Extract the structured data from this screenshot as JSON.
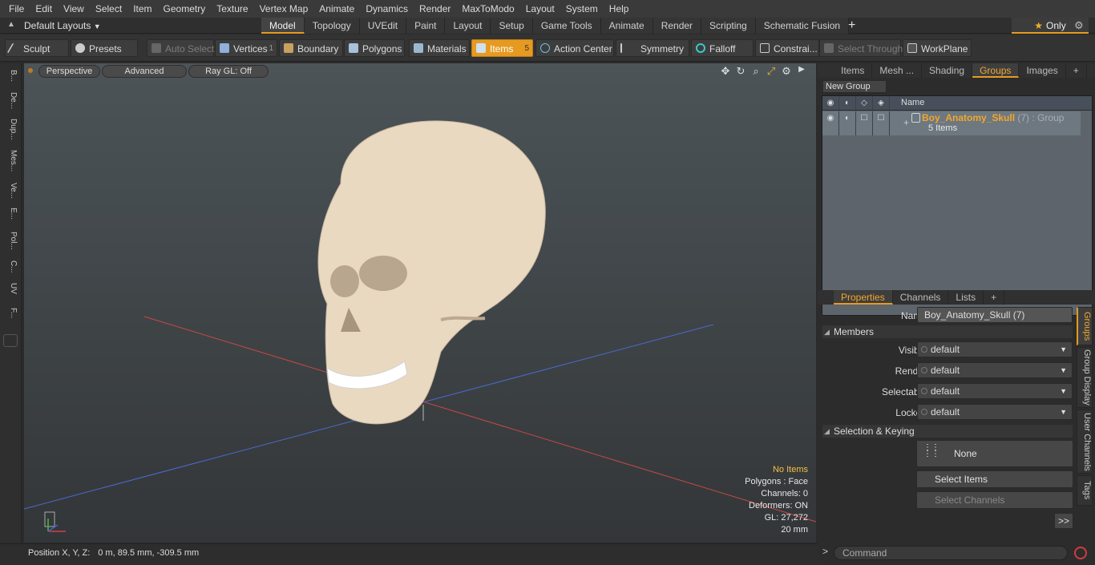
{
  "menu": [
    "File",
    "Edit",
    "View",
    "Select",
    "Item",
    "Geometry",
    "Texture",
    "Vertex Map",
    "Animate",
    "Dynamics",
    "Render",
    "MaxToModo",
    "Layout",
    "System",
    "Help"
  ],
  "layout_dropdown": "Default Layouts",
  "layout_tabs": [
    {
      "label": "Model",
      "active": true
    },
    {
      "label": "Topology"
    },
    {
      "label": "UVEdit"
    },
    {
      "label": "Paint"
    },
    {
      "label": "Layout"
    },
    {
      "label": "Setup"
    },
    {
      "label": "Game Tools"
    },
    {
      "label": "Animate"
    },
    {
      "label": "Render"
    },
    {
      "label": "Scripting"
    },
    {
      "label": "Schematic Fusion"
    }
  ],
  "tab_add": "+",
  "only_label": "Only",
  "toolbar": {
    "sculpt": "Sculpt",
    "presets": "Presets",
    "auto_select": "Auto Select",
    "vertices": "Vertices",
    "vertices_count": "1",
    "boundary": "Boundary",
    "polygons": "Polygons",
    "materials": "Materials",
    "items": "Items",
    "items_count": "5",
    "action_center": "Action Center",
    "symmetry": "Symmetry",
    "falloff": "Falloff",
    "constraints": "Constrai...",
    "select_through": "Select Through",
    "workplane": "WorkPlane"
  },
  "left_strip": [
    "B...",
    "De...",
    "Dup...",
    "Mes...",
    "Ve...",
    "E...",
    "Pol...",
    "C...",
    "UV",
    "F..."
  ],
  "viewport": {
    "view_mode": "Perspective",
    "shading": "Advanced",
    "raygl": "Ray GL: Off",
    "stats": {
      "selection": "No Items",
      "polygons": "Polygons : Face",
      "channels": "Channels: 0",
      "deformers": "Deformers: ON",
      "gl": "GL: 27,272",
      "scale": "20 mm"
    }
  },
  "status_bar": {
    "label": "Position X, Y, Z:",
    "value": "0 m, 89.5 mm, -309.5 mm"
  },
  "panel_top": {
    "tabs": [
      {
        "label": "Items"
      },
      {
        "label": "Mesh ..."
      },
      {
        "label": "Shading"
      },
      {
        "label": "Groups",
        "active": true
      },
      {
        "label": "Images"
      }
    ],
    "new_group": "New Group",
    "col_name": "Name",
    "group": {
      "name": "Boy_Anatomy_Skull",
      "count": "(7)",
      "type": ": Group",
      "sub": "5 Items"
    }
  },
  "panel_props": {
    "tabs": [
      {
        "label": "Properties",
        "active": true
      },
      {
        "label": "Channels"
      },
      {
        "label": "Lists"
      }
    ],
    "name_label": "Name",
    "name_value": "Boy_Anatomy_Skull (7)",
    "members": "Members",
    "rows": [
      {
        "label": "Visible",
        "value": "default"
      },
      {
        "label": "Render",
        "value": "default"
      },
      {
        "label": "Selectable",
        "value": "default"
      },
      {
        "label": "Locked",
        "value": "default"
      }
    ],
    "sel_keying": "Selection & Keying",
    "none_btn": "None",
    "select_items": "Select Items",
    "select_channels": "Select Channels",
    "more": ">>",
    "side_tabs": [
      "Groups",
      "Group Display",
      "User Channels",
      "Tags"
    ]
  },
  "command_placeholder": "Command",
  "colors": {
    "accent": "#e69a21",
    "highlight": "#f3c040"
  }
}
